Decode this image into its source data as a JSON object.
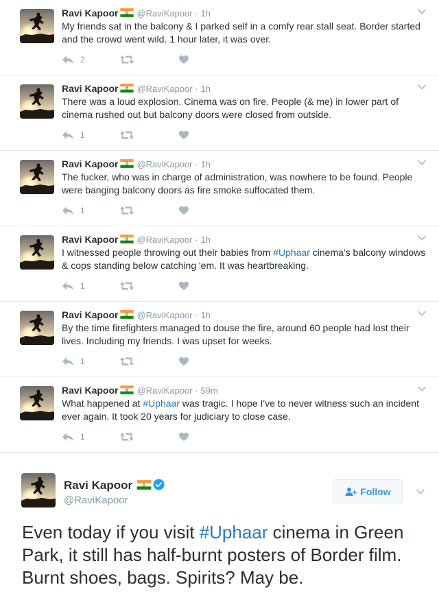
{
  "author": {
    "name": "Ravi Kapoor",
    "handle": "@RaviKapoor",
    "handle_dot": "@RaviKapoor ·"
  },
  "tweets": [
    {
      "time": "1h",
      "text_parts": [
        "My friends sat in the balcony & I parked self in a comfy rear stall seat. Border started and the crowd went wild. 1 hour later, it was over."
      ],
      "replies": "2"
    },
    {
      "time": "1h",
      "text_parts": [
        "There was a loud explosion. Cinema was on fire. People (& me) in lower part of cinema rushed out but balcony doors were closed from outside."
      ],
      "replies": "1"
    },
    {
      "time": "1h",
      "text_parts": [
        "The fucker, who was in charge of administration, was nowhere to be found. People were banging balcony doors as fire smoke suffocated them."
      ],
      "replies": "1"
    },
    {
      "time": "1h",
      "text_before": "I witnessed people throwing out their babies from ",
      "hashtag": "#Uphaar",
      "text_after": " cinema's balcony windows & cops standing below catching 'em. It was heartbreaking.",
      "replies": "1"
    },
    {
      "time": "1h",
      "text_parts": [
        "By the time firefighters managed to douse the fire, around 60 people had lost their lives. Including my friends. I was upset for weeks."
      ],
      "replies": "1"
    },
    {
      "time": "59m",
      "text_before": "What happened at ",
      "hashtag": "#Uphaar",
      "text_after": " was tragic. I hope I've to never witness such an incident ever again. It took 20 years for judiciary to close case.",
      "replies": "1"
    }
  ],
  "featured": {
    "follow_label": "Follow",
    "text_before": "Even today if you visit ",
    "hashtag": "#Uphaar",
    "text_after": " cinema in Green Park, it still has half-burnt posters of Border film. Burnt shoes, bags. Spirits? May be."
  },
  "colors": {
    "link": "#2b7bb9",
    "muted": "#8899a6",
    "icon": "#aab8c2",
    "follow": "#3b94d9",
    "verified": "#1da1f2"
  },
  "icons": [
    "reply-icon",
    "retweet-icon",
    "like-icon",
    "caret-down-icon",
    "india-flag-icon",
    "verified-icon",
    "follow-person-icon"
  ]
}
